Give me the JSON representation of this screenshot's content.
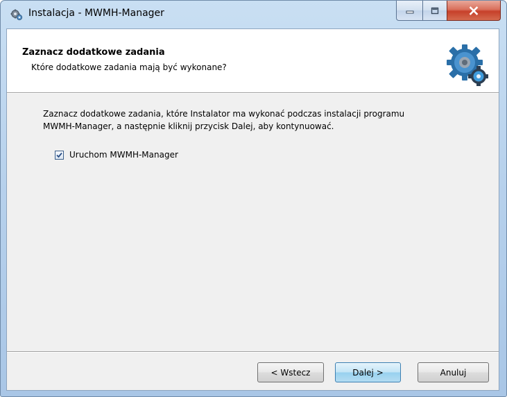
{
  "window": {
    "title": "Instalacja - MWMH-Manager"
  },
  "header": {
    "title": "Zaznacz dodatkowe zadania",
    "subtitle": "Które dodatkowe zadania mają być wykonane?",
    "icon": "gears-icon"
  },
  "body": {
    "description_line1": "Zaznacz dodatkowe zadania, które Instalator ma wykonać podczas instalacji programu",
    "description_line2": "MWMH-Manager, a następnie kliknij przycisk Dalej, aby kontynuować.",
    "task_checkbox": {
      "label": "Uruchom MWMH-Manager",
      "checked": true
    }
  },
  "buttons": {
    "back": "< Wstecz",
    "next": "Dalej >",
    "cancel": "Anuluj"
  },
  "colors": {
    "accent": "#3c7fb1",
    "close_button": "#c7402a",
    "dialog_background": "#f0f0f0"
  }
}
